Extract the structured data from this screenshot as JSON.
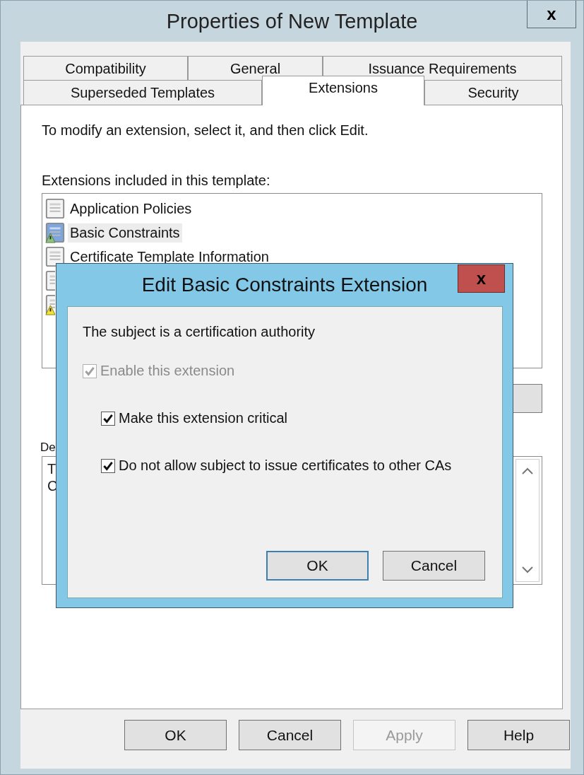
{
  "window": {
    "title": "Properties of New Template",
    "close_label": "x"
  },
  "tab_rows": [
    [
      {
        "label": "Compatibility",
        "selected": false
      },
      {
        "label": "General",
        "selected": false
      },
      {
        "label": "Issuance Requirements",
        "selected": false
      }
    ],
    [
      {
        "label": "Superseded Templates",
        "selected": false
      },
      {
        "label": "Extensions",
        "selected": true
      },
      {
        "label": "Security",
        "selected": false
      }
    ]
  ],
  "extensions": {
    "instruction": "To modify an extension, select it, and then click Edit.",
    "list_label": "Extensions included in this template:",
    "items": [
      {
        "label": "Application Policies",
        "kind": "plain",
        "selected": false
      },
      {
        "label": "Basic Constraints",
        "kind": "info",
        "selected": true
      },
      {
        "label": "Certificate Template Information",
        "kind": "plain",
        "selected": false
      },
      {
        "kind": "plain",
        "selected": false
      },
      {
        "kind": "warning",
        "selected": false
      }
    ],
    "description_label": "De",
    "description_lines": [
      "T",
      "C"
    ]
  },
  "buttons": [
    {
      "label": "OK",
      "disabled": false
    },
    {
      "label": "Cancel",
      "disabled": false
    },
    {
      "label": "Apply",
      "disabled": true
    },
    {
      "label": "Help",
      "disabled": false
    }
  ],
  "dialog": {
    "title": "Edit Basic Constraints Extension",
    "close_label": "x",
    "heading": "The subject is a certification authority",
    "options": [
      {
        "label": "Enable this extension",
        "checked": true,
        "disabled": true,
        "indented": false
      },
      {
        "label": "Make this extension critical",
        "checked": true,
        "disabled": false,
        "indented": true
      },
      {
        "label": "Do not allow subject to issue certificates to other CAs",
        "checked": true,
        "disabled": false,
        "indented": true
      }
    ],
    "buttons": [
      "OK",
      "Cancel"
    ]
  }
}
